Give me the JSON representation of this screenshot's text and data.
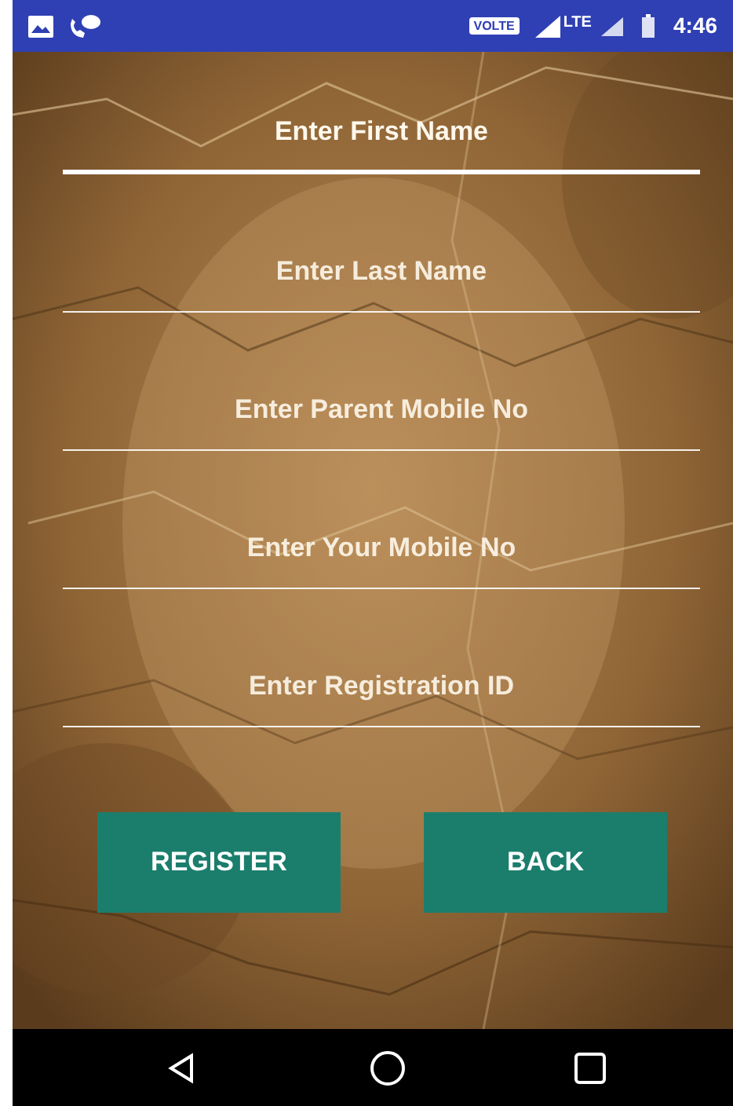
{
  "status_bar": {
    "volte": "VOLTE",
    "network": "LTE",
    "time": "4:46"
  },
  "fields": [
    {
      "placeholder": "Enter First Name",
      "focused": true
    },
    {
      "placeholder": "Enter Last Name",
      "focused": false
    },
    {
      "placeholder": "Enter Parent Mobile No",
      "focused": false
    },
    {
      "placeholder": "Enter Your Mobile No",
      "focused": false
    },
    {
      "placeholder": "Enter Registration ID",
      "focused": false
    }
  ],
  "buttons": [
    {
      "label": "REGISTER"
    },
    {
      "label": "BACK"
    }
  ]
}
